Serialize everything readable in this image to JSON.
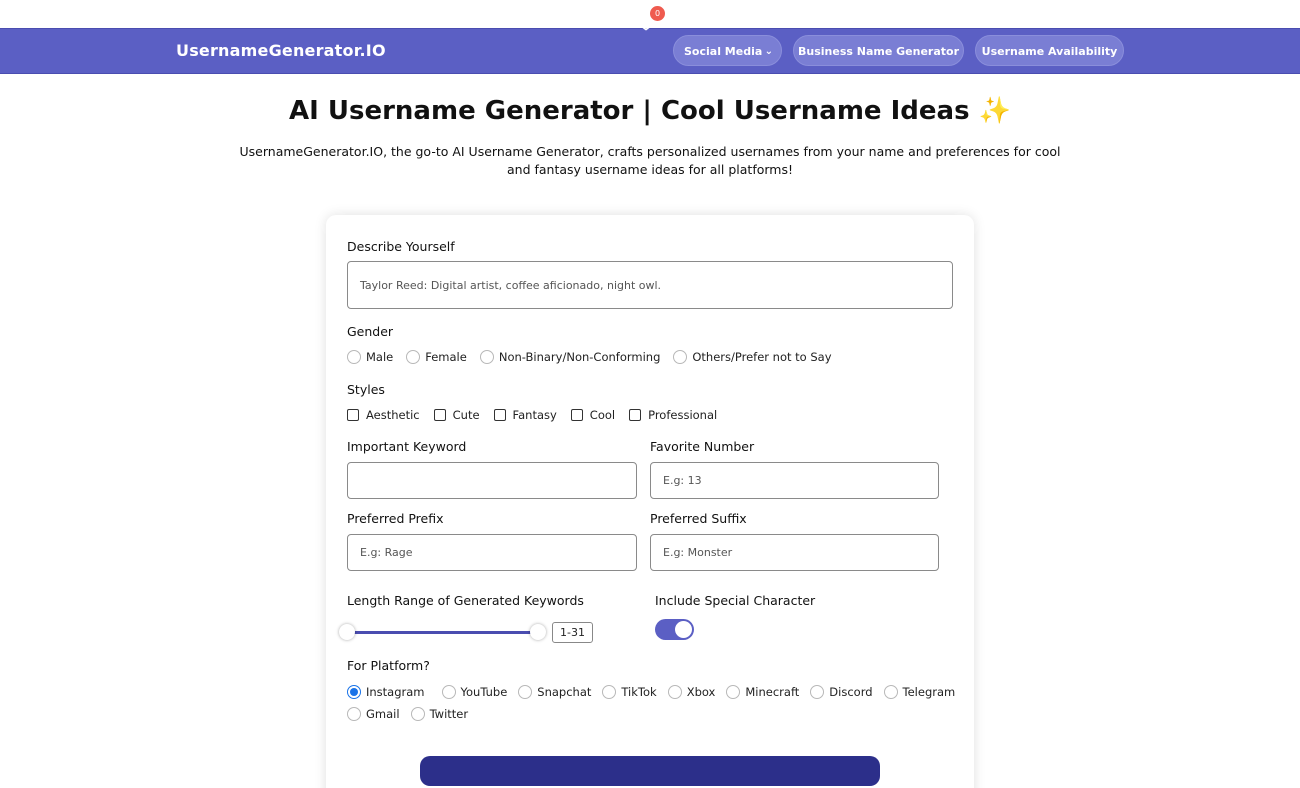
{
  "nav": {
    "brand": "UsernameGenerator.IO",
    "favorites_count": "0",
    "social_media": "Social Media",
    "business_name": "Business Name Generator",
    "availability": "Username Availability"
  },
  "hero": {
    "title": "AI Username Generator | Cool Username Ideas ✨",
    "subtitle": "UsernameGenerator.IO, the go-to AI Username Generator, crafts personalized usernames from your name and preferences for cool and fantasy username ideas for all platforms!"
  },
  "form": {
    "describe_label": "Describe Yourself",
    "describe_placeholder": "Taylor Reed: Digital artist, coffee aficionado, night owl.",
    "gender_label": "Gender",
    "genders": [
      "Male",
      "Female",
      "Non-Binary/Non-Conforming",
      "Others/Prefer not to Say"
    ],
    "styles_label": "Styles",
    "styles": [
      "Aesthetic",
      "Cute",
      "Fantasy",
      "Cool",
      "Professional"
    ],
    "keyword_label": "Important Keyword",
    "keyword_value": "",
    "number_label": "Favorite Number",
    "number_placeholder": "E.g: 13",
    "prefix_label": "Preferred Prefix",
    "prefix_placeholder": "E.g: Rage",
    "suffix_label": "Preferred Suffix",
    "suffix_placeholder": "E.g: Monster",
    "length_label": "Length Range of Generated Keywords",
    "length_range": "1-31",
    "special_label": "Include Special Character",
    "special_enabled": true,
    "platform_label": "For Platform?",
    "platforms": [
      "Instagram",
      "YouTube",
      "Snapchat",
      "TikTok",
      "Xbox",
      "Minecraft",
      "Discord",
      "Telegram",
      "Gmail",
      "Twitter"
    ],
    "selected_platform": "Instagram"
  },
  "colors": {
    "navbar": "#5b5fc4",
    "accent": "#1a73e8",
    "badge": "#ef5b4f",
    "button": "#2c2f8a"
  }
}
